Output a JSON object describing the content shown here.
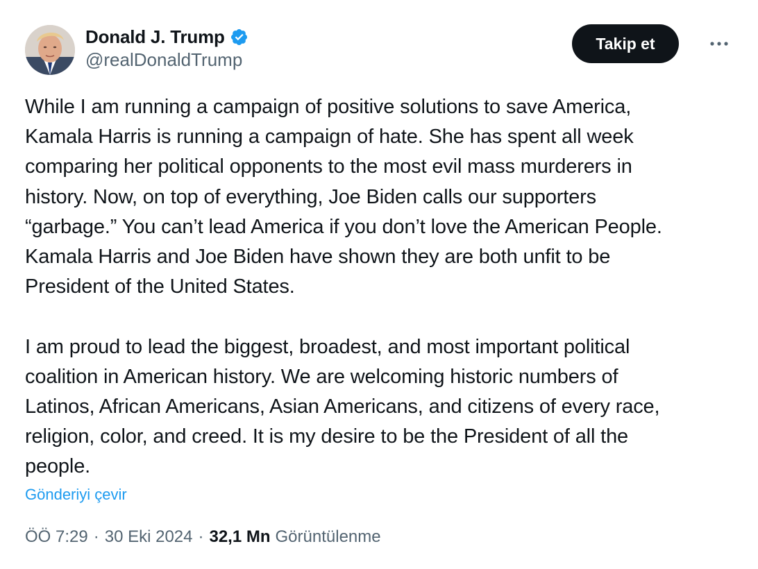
{
  "author": {
    "display_name": "Donald J. Trump",
    "handle": "@realDonaldTrump",
    "verified": true,
    "verified_color": "#1d9bf0"
  },
  "actions": {
    "follow_label": "Takip et",
    "more_icon": "more-horizontal-icon"
  },
  "tweet": {
    "paragraphs": [
      "While I am running a campaign of positive solutions to save America,\nKamala Harris is running a campaign of hate. She has spent all week\ncomparing her political opponents to the most evil mass murderers in\nhistory. Now, on top of everything, Joe Biden calls our supporters\n“garbage.” You can’t lead America if you don’t love the American People.\nKamala Harris and Joe Biden have shown they are both unfit to be\nPresident of the United States.",
      "I am proud to lead the biggest, broadest, and most important political\ncoalition in American history. We are welcoming historic numbers of\nLatinos, African Americans, Asian Americans, and citizens of every race,\nreligion, color, and creed. It is my desire to be the President of all the\npeople."
    ],
    "translate_label": "Gönderiyi çevir"
  },
  "meta": {
    "time": "ÖÖ 7:29",
    "separator": "·",
    "date": "30 Eki 2024",
    "views_count": "32,1 Mn",
    "views_label": "Görüntülenme"
  },
  "colors": {
    "text_primary": "#0f1419",
    "text_secondary": "#536471",
    "link": "#1d9bf0",
    "button_bg": "#0f1419",
    "button_text": "#ffffff"
  }
}
